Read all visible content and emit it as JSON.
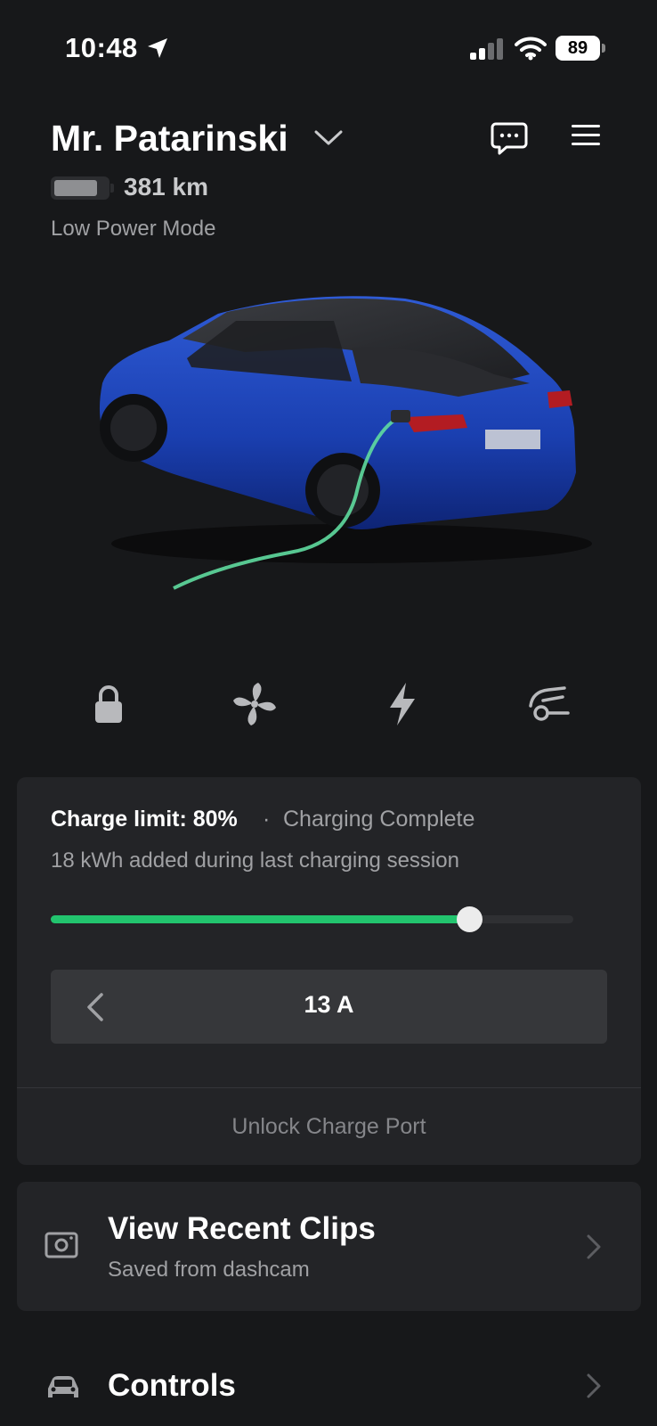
{
  "status_bar": {
    "time": "10:48",
    "battery_percent": "89"
  },
  "header": {
    "vehicle_name": "Mr. Patarinski",
    "range": "381 km",
    "power_mode": "Low Power Mode"
  },
  "quick_actions": [
    {
      "name": "lock",
      "icon": "lock-icon"
    },
    {
      "name": "climate",
      "icon": "fan-icon"
    },
    {
      "name": "charge",
      "icon": "bolt-icon"
    },
    {
      "name": "charge-port",
      "icon": "charge-port-icon"
    }
  ],
  "charging": {
    "charge_limit_label": "Charge limit: 80%",
    "separator": "·",
    "status": "Charging Complete",
    "energy_added": "18 kWh added during last charging session",
    "charge_limit_fraction": 0.8,
    "amperage": "13 A",
    "unlock_label": "Unlock Charge Port",
    "accent_color": "#22c46e"
  },
  "clips": {
    "title": "View Recent Clips",
    "subtitle": "Saved from dashcam"
  },
  "controls": {
    "label": "Controls"
  }
}
